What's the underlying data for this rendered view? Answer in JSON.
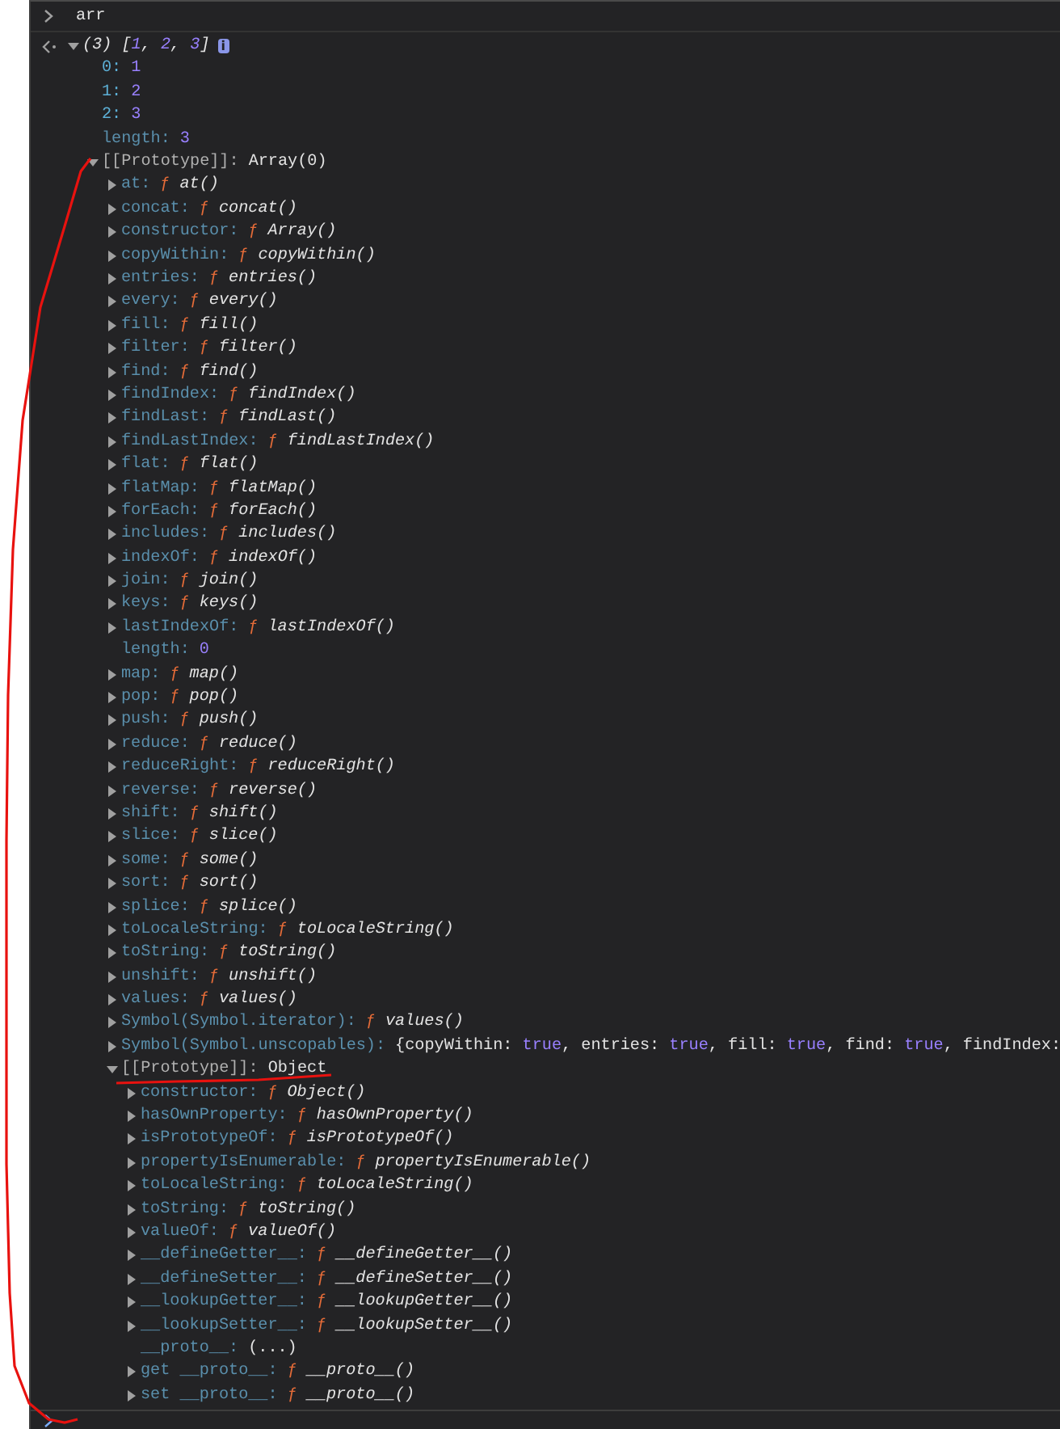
{
  "console": {
    "input": {
      "text": "arr"
    },
    "output": {
      "expanded": true,
      "info_badge": "i",
      "summary": [
        {
          "text": "(3) [",
          "kind": "plain"
        },
        {
          "text": "1",
          "kind": "number"
        },
        {
          "text": ", ",
          "kind": "plain"
        },
        {
          "text": "2",
          "kind": "number"
        },
        {
          "text": ", ",
          "kind": "plain"
        },
        {
          "text": "3",
          "kind": "number"
        },
        {
          "text": "]",
          "kind": "plain"
        }
      ],
      "children": [
        {
          "key": "0:",
          "dimmed": false,
          "kind": "number",
          "value": "1"
        },
        {
          "key": "1:",
          "dimmed": false,
          "kind": "number",
          "value": "2"
        },
        {
          "key": "2:",
          "dimmed": false,
          "kind": "number",
          "value": "3"
        },
        {
          "key": "length:",
          "dimmed": true,
          "kind": "number",
          "value": "3"
        },
        {
          "key": "[[Prototype]]:",
          "kind": "prototype",
          "value": "Array(0)",
          "expanded": true,
          "children": [
            {
              "key": "at:",
              "dimmed": true,
              "kind": "function",
              "sign": "ƒ",
              "value": "at()",
              "expanded": false
            },
            {
              "key": "concat:",
              "dimmed": true,
              "kind": "function",
              "sign": "ƒ",
              "value": "concat()",
              "expanded": false
            },
            {
              "key": "constructor:",
              "dimmed": true,
              "kind": "function",
              "sign": "ƒ",
              "value": "Array()",
              "expanded": false
            },
            {
              "key": "copyWithin:",
              "dimmed": true,
              "kind": "function",
              "sign": "ƒ",
              "value": "copyWithin()",
              "expanded": false
            },
            {
              "key": "entries:",
              "dimmed": true,
              "kind": "function",
              "sign": "ƒ",
              "value": "entries()",
              "expanded": false
            },
            {
              "key": "every:",
              "dimmed": true,
              "kind": "function",
              "sign": "ƒ",
              "value": "every()",
              "expanded": false
            },
            {
              "key": "fill:",
              "dimmed": true,
              "kind": "function",
              "sign": "ƒ",
              "value": "fill()",
              "expanded": false
            },
            {
              "key": "filter:",
              "dimmed": true,
              "kind": "function",
              "sign": "ƒ",
              "value": "filter()",
              "expanded": false
            },
            {
              "key": "find:",
              "dimmed": true,
              "kind": "function",
              "sign": "ƒ",
              "value": "find()",
              "expanded": false
            },
            {
              "key": "findIndex:",
              "dimmed": true,
              "kind": "function",
              "sign": "ƒ",
              "value": "findIndex()",
              "expanded": false
            },
            {
              "key": "findLast:",
              "dimmed": true,
              "kind": "function",
              "sign": "ƒ",
              "value": "findLast()",
              "expanded": false
            },
            {
              "key": "findLastIndex:",
              "dimmed": true,
              "kind": "function",
              "sign": "ƒ",
              "value": "findLastIndex()",
              "expanded": false
            },
            {
              "key": "flat:",
              "dimmed": true,
              "kind": "function",
              "sign": "ƒ",
              "value": "flat()",
              "expanded": false
            },
            {
              "key": "flatMap:",
              "dimmed": true,
              "kind": "function",
              "sign": "ƒ",
              "value": "flatMap()",
              "expanded": false
            },
            {
              "key": "forEach:",
              "dimmed": true,
              "kind": "function",
              "sign": "ƒ",
              "value": "forEach()",
              "expanded": false
            },
            {
              "key": "includes:",
              "dimmed": true,
              "kind": "function",
              "sign": "ƒ",
              "value": "includes()",
              "expanded": false
            },
            {
              "key": "indexOf:",
              "dimmed": true,
              "kind": "function",
              "sign": "ƒ",
              "value": "indexOf()",
              "expanded": false
            },
            {
              "key": "join:",
              "dimmed": true,
              "kind": "function",
              "sign": "ƒ",
              "value": "join()",
              "expanded": false
            },
            {
              "key": "keys:",
              "dimmed": true,
              "kind": "function",
              "sign": "ƒ",
              "value": "keys()",
              "expanded": false
            },
            {
              "key": "lastIndexOf:",
              "dimmed": true,
              "kind": "function",
              "sign": "ƒ",
              "value": "lastIndexOf()",
              "expanded": false
            },
            {
              "key": "length:",
              "dimmed": true,
              "kind": "number",
              "value": "0"
            },
            {
              "key": "map:",
              "dimmed": true,
              "kind": "function",
              "sign": "ƒ",
              "value": "map()",
              "expanded": false
            },
            {
              "key": "pop:",
              "dimmed": true,
              "kind": "function",
              "sign": "ƒ",
              "value": "pop()",
              "expanded": false
            },
            {
              "key": "push:",
              "dimmed": true,
              "kind": "function",
              "sign": "ƒ",
              "value": "push()",
              "expanded": false
            },
            {
              "key": "reduce:",
              "dimmed": true,
              "kind": "function",
              "sign": "ƒ",
              "value": "reduce()",
              "expanded": false
            },
            {
              "key": "reduceRight:",
              "dimmed": true,
              "kind": "function",
              "sign": "ƒ",
              "value": "reduceRight()",
              "expanded": false
            },
            {
              "key": "reverse:",
              "dimmed": true,
              "kind": "function",
              "sign": "ƒ",
              "value": "reverse()",
              "expanded": false
            },
            {
              "key": "shift:",
              "dimmed": true,
              "kind": "function",
              "sign": "ƒ",
              "value": "shift()",
              "expanded": false
            },
            {
              "key": "slice:",
              "dimmed": true,
              "kind": "function",
              "sign": "ƒ",
              "value": "slice()",
              "expanded": false
            },
            {
              "key": "some:",
              "dimmed": true,
              "kind": "function",
              "sign": "ƒ",
              "value": "some()",
              "expanded": false
            },
            {
              "key": "sort:",
              "dimmed": true,
              "kind": "function",
              "sign": "ƒ",
              "value": "sort()",
              "expanded": false
            },
            {
              "key": "splice:",
              "dimmed": true,
              "kind": "function",
              "sign": "ƒ",
              "value": "splice()",
              "expanded": false
            },
            {
              "key": "toLocaleString:",
              "dimmed": true,
              "kind": "function",
              "sign": "ƒ",
              "value": "toLocaleString()",
              "expanded": false
            },
            {
              "key": "toString:",
              "dimmed": true,
              "kind": "function",
              "sign": "ƒ",
              "value": "toString()",
              "expanded": false
            },
            {
              "key": "unshift:",
              "dimmed": true,
              "kind": "function",
              "sign": "ƒ",
              "value": "unshift()",
              "expanded": false
            },
            {
              "key": "values:",
              "dimmed": true,
              "kind": "function",
              "sign": "ƒ",
              "value": "values()",
              "expanded": false
            },
            {
              "key": "Symbol(Symbol.iterator):",
              "dimmed": true,
              "kind": "function",
              "sign": "ƒ",
              "value": "values()",
              "expanded": false
            },
            {
              "key": "Symbol(Symbol.unscopables):",
              "dimmed": true,
              "kind": "preview",
              "expanded": false,
              "tokens": [
                {
                  "text": "{copyWithin: ",
                  "kind": "plain"
                },
                {
                  "text": "true",
                  "kind": "boolean"
                },
                {
                  "text": ", entries: ",
                  "kind": "plain"
                },
                {
                  "text": "true",
                  "kind": "boolean"
                },
                {
                  "text": ", fill: ",
                  "kind": "plain"
                },
                {
                  "text": "true",
                  "kind": "boolean"
                },
                {
                  "text": ", find: ",
                  "kind": "plain"
                },
                {
                  "text": "true",
                  "kind": "boolean"
                },
                {
                  "text": ", findIndex:",
                  "kind": "plain"
                }
              ]
            },
            {
              "key": "[[Prototype]]:",
              "kind": "prototype",
              "value": "Object",
              "expanded": true,
              "children": [
                {
                  "key": "constructor:",
                  "dimmed": true,
                  "kind": "function",
                  "sign": "ƒ",
                  "value": "Object()",
                  "expanded": false
                },
                {
                  "key": "hasOwnProperty:",
                  "dimmed": true,
                  "kind": "function",
                  "sign": "ƒ",
                  "value": "hasOwnProperty()",
                  "expanded": false
                },
                {
                  "key": "isPrototypeOf:",
                  "dimmed": true,
                  "kind": "function",
                  "sign": "ƒ",
                  "value": "isPrototypeOf()",
                  "expanded": false
                },
                {
                  "key": "propertyIsEnumerable:",
                  "dimmed": true,
                  "kind": "function",
                  "sign": "ƒ",
                  "value": "propertyIsEnumerable()",
                  "expanded": false
                },
                {
                  "key": "toLocaleString:",
                  "dimmed": true,
                  "kind": "function",
                  "sign": "ƒ",
                  "value": "toLocaleString()",
                  "expanded": false
                },
                {
                  "key": "toString:",
                  "dimmed": true,
                  "kind": "function",
                  "sign": "ƒ",
                  "value": "toString()",
                  "expanded": false
                },
                {
                  "key": "valueOf:",
                  "dimmed": true,
                  "kind": "function",
                  "sign": "ƒ",
                  "value": "valueOf()",
                  "expanded": false
                },
                {
                  "key": "__defineGetter__:",
                  "dimmed": true,
                  "kind": "function",
                  "sign": "ƒ",
                  "value": "__defineGetter__()",
                  "expanded": false
                },
                {
                  "key": "__defineSetter__:",
                  "dimmed": true,
                  "kind": "function",
                  "sign": "ƒ",
                  "value": "__defineSetter__()",
                  "expanded": false
                },
                {
                  "key": "__lookupGetter__:",
                  "dimmed": true,
                  "kind": "function",
                  "sign": "ƒ",
                  "value": "__lookupGetter__()",
                  "expanded": false
                },
                {
                  "key": "__lookupSetter__:",
                  "dimmed": true,
                  "kind": "function",
                  "sign": "ƒ",
                  "value": "__lookupSetter__()",
                  "expanded": false
                },
                {
                  "key": "__proto__:",
                  "dimmed": true,
                  "kind": "object",
                  "value": "(...)"
                },
                {
                  "key": "get __proto__:",
                  "dimmed": true,
                  "kind": "function",
                  "sign": "ƒ",
                  "value": "__proto__()",
                  "expanded": false
                },
                {
                  "key": "set __proto__:",
                  "dimmed": true,
                  "kind": "function",
                  "sign": "ƒ",
                  "value": "__proto__()",
                  "expanded": false
                }
              ]
            }
          ]
        }
      ]
    }
  }
}
